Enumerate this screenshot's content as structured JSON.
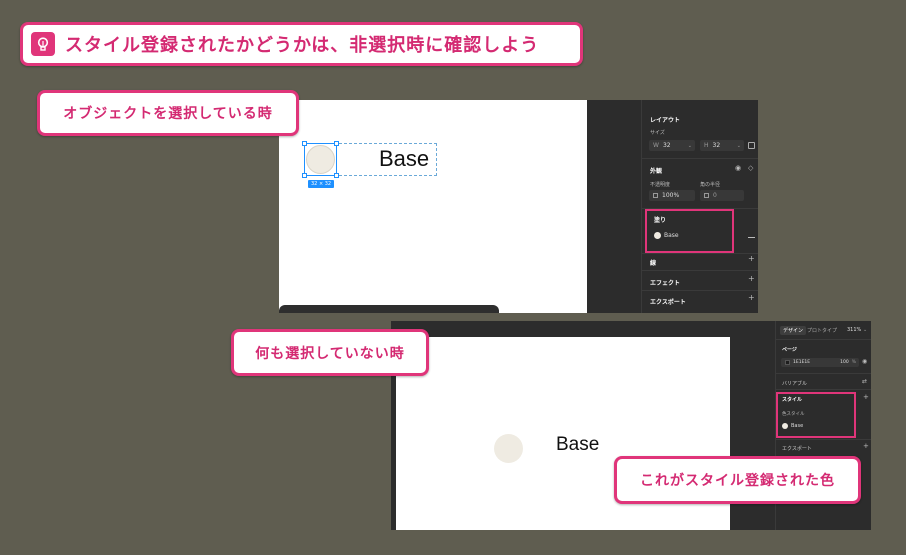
{
  "banner": {
    "text": "スタイル登録されたかどうかは、非選択時に確認しよう"
  },
  "callouts": {
    "selected": "オブジェクトを選択している時",
    "nothing_selected": "何も選択していない時",
    "style_registered": "これがスタイル登録された色"
  },
  "shot1": {
    "canvas": {
      "label": "Base",
      "size_badge": "32 × 32"
    },
    "panel": {
      "layout_title": "レイアウト",
      "size_label": "サイズ",
      "w_label": "W",
      "w_value": "32",
      "h_label": "H",
      "h_value": "32",
      "appearance_title": "外観",
      "opacity_label": "不透明度",
      "opacity_value": "100%",
      "radius_label": "角の半径",
      "radius_value": "0",
      "fill_title": "塗り",
      "fill_style": "Base",
      "stroke_title": "線",
      "effects_title": "エフェクト",
      "export_title": "エクスポート"
    }
  },
  "shot2": {
    "canvas": {
      "label": "Base"
    },
    "panel": {
      "tab_design": "デザイン",
      "tab_prototype": "プロトタイプ",
      "zoom": "311%",
      "page_title": "ページ",
      "page_color": "1E1E1E",
      "page_opacity": "100",
      "page_opacity_unit": "%",
      "variables_title": "バリアブル",
      "styles_title": "スタイル",
      "color_styles_label": "色スタイル",
      "style_name": "Base",
      "export_title": "エクスポート"
    }
  },
  "colors": {
    "accent": "#e0357a",
    "base_fill": "#efebe2",
    "selection": "#1e90ff"
  }
}
